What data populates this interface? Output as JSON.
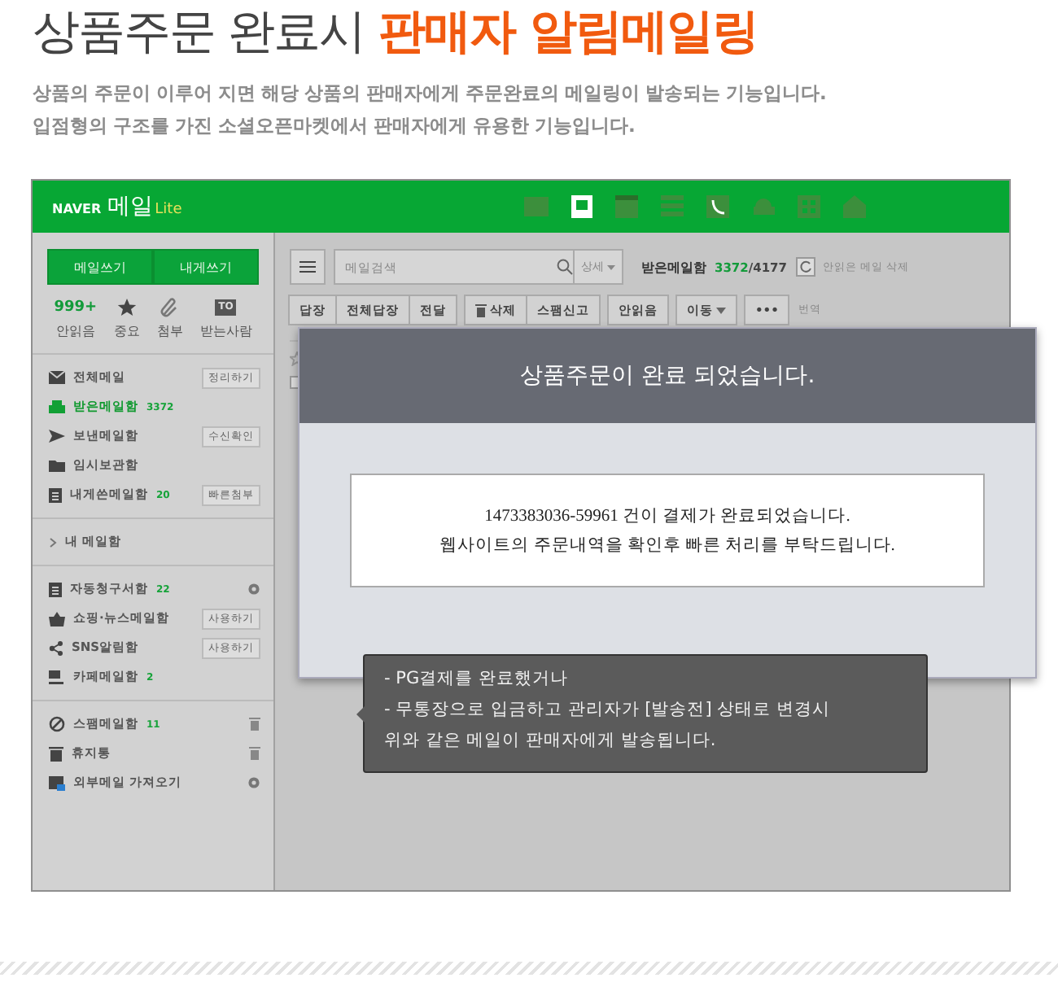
{
  "heading": {
    "plain": "상품주문 완료시",
    "accent": "판매자 알림메일링"
  },
  "description": [
    "상품의 주문이 이루어 지면 해당 상품의 판매자에게 주문완료의 메일링이 발송되는 기능입니다.",
    "입점형의 구조를 가진 소셜오픈마켓에서 판매자에게 유용한 기능입니다."
  ],
  "mail": {
    "logo": {
      "brand": "NAVER",
      "product": "메일",
      "edition": "Lite"
    },
    "compose_buttons": [
      "메일쓰기",
      "내게쓰기"
    ],
    "quick_filters": [
      {
        "kind": "count",
        "top": "999+",
        "label": "안읽음"
      },
      {
        "kind": "star",
        "label": "중요"
      },
      {
        "kind": "clip",
        "label": "첨부"
      },
      {
        "kind": "tag",
        "top": "TO",
        "label": "받는사람"
      }
    ],
    "folder_groups": [
      [
        {
          "kind": "all",
          "name": "전체메일",
          "action": "정리하기",
          "selected": false
        },
        {
          "kind": "inbox",
          "name": "받은메일함",
          "count": "3372",
          "selected": true
        },
        {
          "kind": "sent",
          "name": "보낸메일함",
          "action": "수신확인",
          "selected": false
        },
        {
          "kind": "drafts",
          "name": "임시보관함",
          "selected": false
        },
        {
          "kind": "self",
          "name": "내게쓴메일함",
          "count": "20",
          "action": "빠른첨부",
          "selected": false
        }
      ],
      [
        {
          "kind": "expander",
          "name": "내 메일함",
          "selected": false
        }
      ],
      [
        {
          "kind": "bills",
          "name": "자동청구서함",
          "count": "22",
          "trailing": {
            "kind": "gear"
          },
          "selected": false
        },
        {
          "kind": "shopping",
          "name": "쇼핑·뉴스메일함",
          "action": "사용하기",
          "selected": false
        },
        {
          "kind": "sns",
          "name": "SNS알림함",
          "action": "사용하기",
          "selected": false
        },
        {
          "kind": "cafe",
          "name": "카페메일함",
          "count": "2",
          "selected": false
        }
      ],
      [
        {
          "kind": "spam",
          "name": "스팸메일함",
          "count": "11",
          "trailing": {
            "kind": "trash"
          },
          "selected": false
        },
        {
          "kind": "trash",
          "name": "휴지통",
          "trailing": {
            "kind": "trash"
          },
          "selected": false
        },
        {
          "kind": "external",
          "name": "외부메일 가져오기",
          "trailing": {
            "kind": "gear"
          },
          "selected": false
        }
      ]
    ],
    "search": {
      "placeholder": "메일검색",
      "detail": "상세"
    },
    "folder_title": "받은메일함",
    "unread": "3372",
    "total": "/4177",
    "delete_unread": "안읽은 메일 삭제",
    "action_groups": [
      [
        {
          "kind": "plain",
          "label": "답장"
        },
        {
          "kind": "plain",
          "label": "전체답장"
        },
        {
          "kind": "plain",
          "label": "전달"
        }
      ],
      [
        {
          "kind": "trash",
          "label": "삭제"
        },
        {
          "kind": "plain",
          "label": "스팸신고"
        }
      ],
      [
        {
          "kind": "plain",
          "label": "안읽음"
        }
      ],
      [
        {
          "kind": "caret",
          "label": "이동"
        }
      ],
      [
        {
          "kind": "plain",
          "label": "•••"
        }
      ]
    ],
    "translate": "번역",
    "list_checkbox": {
      "checked": false
    }
  },
  "modal": {
    "title": "상품주문이 완료 되었습니다.",
    "message": [
      "1473383036-59961 건이 결제가 완료되었습니다.",
      "웹사이트의 주문내역을 확인후 빠른 처리를 부탁드립니다."
    ]
  },
  "tooltip": [
    "- PG결제를 완료했거나",
    "- 무통장으로 입금하고 관리자가 [발송전] 상태로 변경시",
    "위와 같은 메일이 판매자에게 발송됩니다."
  ]
}
